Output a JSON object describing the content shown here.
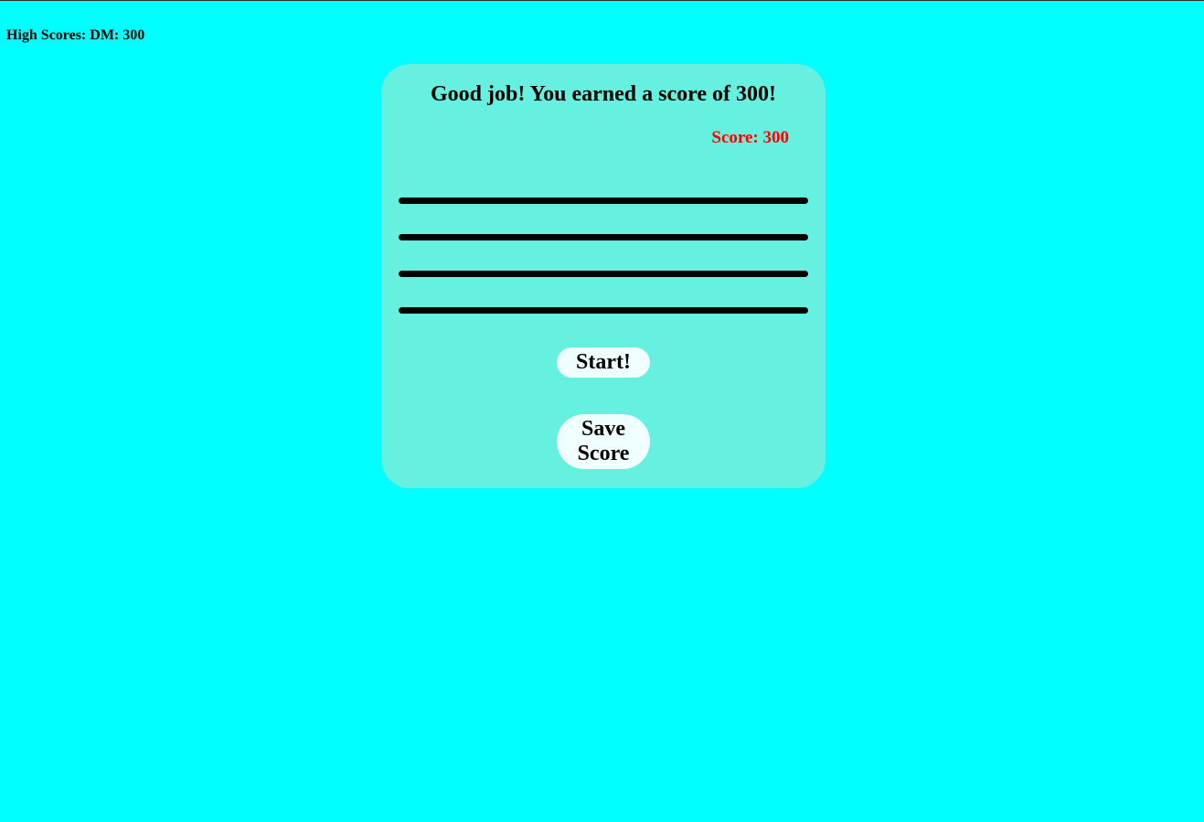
{
  "header": {
    "high_scores": "High Scores: DM: 300"
  },
  "panel": {
    "title": "Good job! You earned a score of 300!",
    "score": "Score: 300",
    "answer_lines": 4,
    "start_label": "Start!",
    "save_label": "Save\nScore"
  },
  "colors": {
    "background": "#00ffff",
    "panel": "#66f0e0",
    "score_text": "#ff0000",
    "button": "#f0ffff"
  }
}
